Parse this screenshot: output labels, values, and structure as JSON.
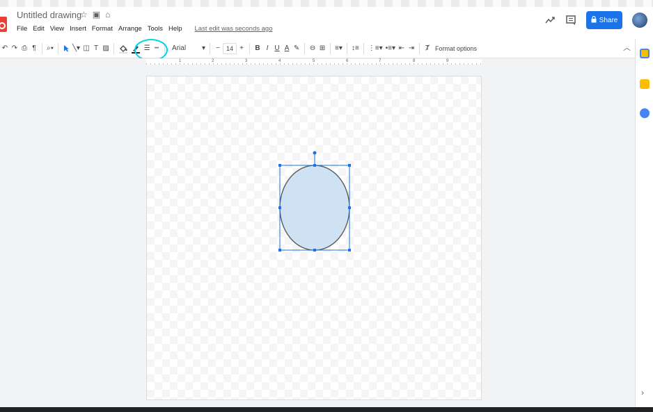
{
  "doc": {
    "title": "Untitled drawing",
    "menus": [
      "File",
      "Edit",
      "View",
      "Insert",
      "Format",
      "Arrange",
      "Tools",
      "Help"
    ],
    "last_edit": "Last edit was seconds ago"
  },
  "header": {
    "share_label": "Share",
    "share_icon": "lock-icon"
  },
  "toolbar": {
    "font_name": "Arial",
    "font_size": "14",
    "bold": "B",
    "italic": "I",
    "underline": "U",
    "text_color": "A",
    "format_options": "Format options"
  },
  "ruler": {
    "numbers": [
      "1",
      "2",
      "3",
      "4",
      "5",
      "6",
      "7",
      "8",
      "9"
    ]
  },
  "shape": {
    "type": "ellipse",
    "fill_color": "#cfe2f3",
    "stroke_color": "#595959",
    "selection_color": "#1a73e8",
    "selected": true
  },
  "colors": {
    "accent": "#1a73e8",
    "highlight_ring": "#00d6e6"
  },
  "side_panel": {
    "icons": [
      "calendar-icon",
      "keep-icon",
      "tasks-icon"
    ],
    "expand_icon": "chevron-right-icon"
  }
}
